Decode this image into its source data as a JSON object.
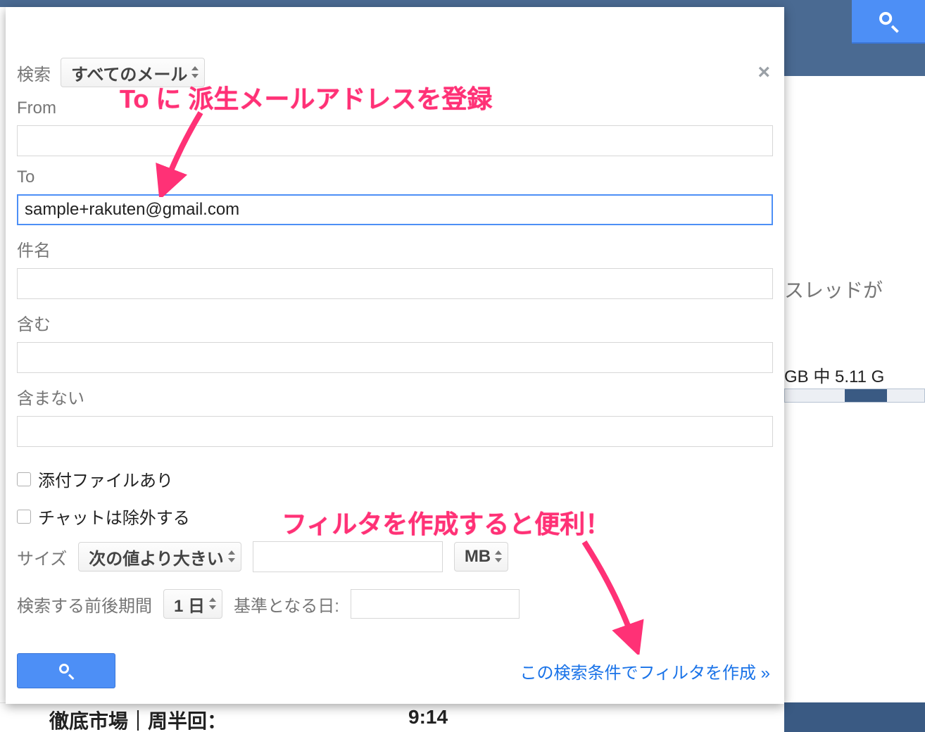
{
  "form": {
    "search_label": "検索",
    "scope_selected": "すべてのメール",
    "from_label": "From",
    "from_value": "",
    "to_label": "To",
    "to_value": "sample+rakuten@gmail.com",
    "subject_label": "件名",
    "subject_value": "",
    "includes_label": "含む",
    "includes_value": "",
    "excludes_label": "含まない",
    "excludes_value": "",
    "has_attachment_label": "添付ファイルあり",
    "exclude_chats_label": "チャットは除外する",
    "size_label": "サイズ",
    "size_compare_selected": "次の値より大きい",
    "size_value": "",
    "size_unit_selected": "MB",
    "date_range_label": "検索する前後期間",
    "date_range_selected": "1 日",
    "date_base_label": "基準となる日:",
    "date_base_value": ""
  },
  "actions": {
    "create_filter_link": "この検索条件でフィルタを作成 »"
  },
  "annotations": {
    "anno1": "To に 派生メールアドレスを登録",
    "anno2": "フィルタを作成すると便利！"
  },
  "background": {
    "thread_text": "スレッドが",
    "gb_text": "GB 中 5.11 G",
    "bottom_snippet1": "徹底市場｜周半回：",
    "bottom_snippet2": "9:14"
  }
}
